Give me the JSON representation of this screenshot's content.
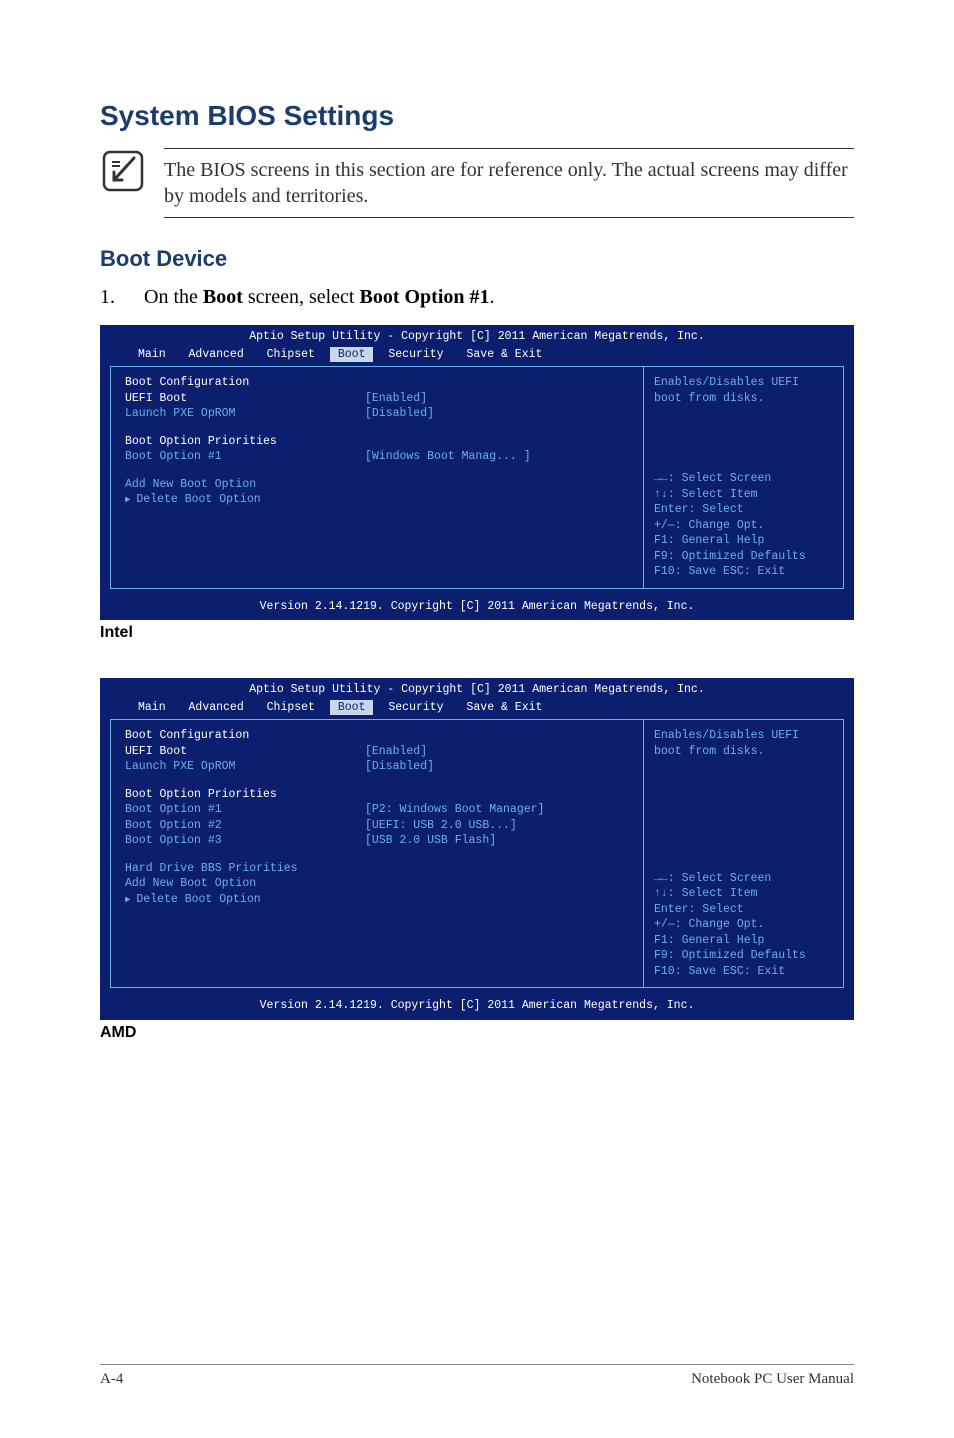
{
  "page": {
    "title": "System BIOS Settings",
    "note": "The BIOS screens in this section are for reference only. The actual screens may differ by models and territories.",
    "h2": "Boot Device",
    "step_num": "1.",
    "step_text_pre": "On the ",
    "step_text_bold1": "Boot",
    "step_text_mid": " screen, select ",
    "step_text_bold2": "Boot Option #1",
    "step_text_post": ".",
    "caption1": "Intel",
    "caption2": "AMD",
    "footer_left": "A-4",
    "footer_right": "Notebook PC User Manual"
  },
  "bios_common": {
    "title": "Aptio Setup Utility - Copyright [C] 2011 American Megatrends, Inc.",
    "tabs": {
      "main": "Main",
      "advanced": "Advanced",
      "chipset": "Chipset",
      "boot": "Boot",
      "security": "Security",
      "save": "Save & Exit"
    },
    "footer": "Version 2.14.1219. Copyright [C] 2011 American Megatrends, Inc.",
    "keys": {
      "l1": "→←:  Select Screen",
      "l2": "↑↓:    Select Item",
      "l3": "Enter: Select",
      "l4": "+/—:  Change Opt.",
      "l5": "F1:    General Help",
      "l6": "F9:    Optimized Defaults",
      "l7": "F10:  Save    ESC: Exit"
    }
  },
  "bios1": {
    "help": "Enables/Disables UEFI boot from disks.",
    "rows": {
      "cfg": "Boot Configuration",
      "uefi": "UEFI Boot",
      "uefi_v": "[Enabled]",
      "pxe": "Launch PXE OpROM",
      "pxe_v": "[Disabled]",
      "prio": "Boot Option Priorities",
      "b1": "Boot Option #1",
      "b1_v": "[Windows Boot Manag... ]",
      "add": "Add New Boot Option",
      "del": "Delete Boot Option"
    }
  },
  "bios2": {
    "help": "Enables/Disables UEFI boot from disks.",
    "rows": {
      "cfg": "Boot Configuration",
      "uefi": "UEFI Boot",
      "uefi_v": "[Enabled]",
      "pxe": "Launch PXE OpROM",
      "pxe_v": "[Disabled]",
      "prio": "Boot Option Priorities",
      "b1": "Boot Option #1",
      "b1_v": "[P2:  Windows Boot Manager]",
      "b2": "Boot Option #2",
      "b2_v": "[UEFI: USB 2.0 USB...]",
      "b3": "Boot Option #3",
      "b3_v": "[USB 2.0 USB Flash]",
      "hd": "Hard Drive BBS Priorities",
      "add": "Add New Boot Option",
      "del": "Delete Boot Option"
    }
  }
}
